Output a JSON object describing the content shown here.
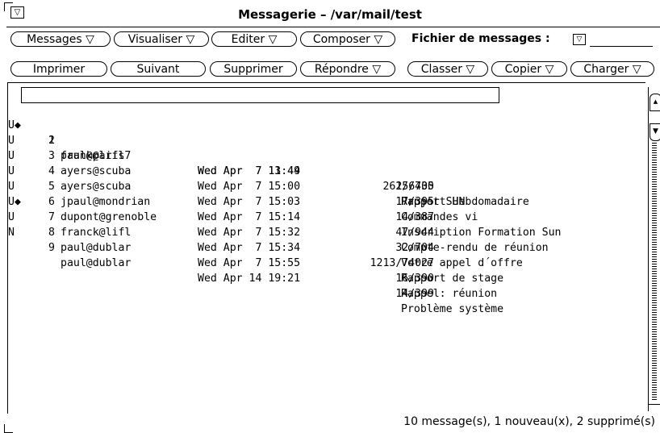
{
  "window": {
    "menu_glyph": "▽",
    "title": "Messagerie  – /var/mail/test"
  },
  "toolbar_row1": [
    {
      "label": "Messages ▽"
    },
    {
      "label": "Visualiser ▽"
    },
    {
      "label": "Editer   ▽"
    },
    {
      "label": "Composer ▽"
    }
  ],
  "mail_file": {
    "label": "Fichier de messages :",
    "dropdown_glyph": "▽",
    "value": ""
  },
  "toolbar_row2": [
    {
      "label": "Imprimer"
    },
    {
      "label": "Suivant"
    },
    {
      "label": "Supprimer"
    },
    {
      "label": "Répondre  ▽"
    },
    {
      "label": "Classer ▽"
    },
    {
      "label": "Copier ▽"
    },
    {
      "label": "Charger ▽"
    }
  ],
  "messages": [
    {
      "status": "",
      "num": "1",
      "from": "frank@lifl",
      "date": "Wed Apr  7 11:44",
      "size": "15/430",
      "subject": "Projet SUN",
      "selected": true
    },
    {
      "status": "U◆",
      "num": "2",
      "from": "paul@paris7",
      "date": "Wed Apr  7 13:49",
      "size": "262/6705",
      "subject": "Rapport Hebdomadaire"
    },
    {
      "status": "U",
      "num": "3",
      "from": "ayers@scuba",
      "date": "Wed Apr  7 15:00",
      "size": "17/395",
      "subject": "Commandes vi"
    },
    {
      "status": "U",
      "num": "4",
      "from": "ayers@scuba",
      "date": "Wed Apr  7 15:03",
      "size": "14/387",
      "subject": "Inscription Formation Sun"
    },
    {
      "status": "U",
      "num": "5",
      "from": "jpaul@mondrian",
      "date": "Wed Apr  7 15:14",
      "size": "47/944",
      "subject": "Compte-rendu de réunion"
    },
    {
      "status": "U",
      "num": "6",
      "from": "dupont@grenoble",
      "date": "Wed Apr  7 15:32",
      "size": "32/704",
      "subject": "Votre appel d´offre"
    },
    {
      "status": "U◆",
      "num": "7",
      "from": "franck@lifl",
      "date": "Wed Apr  7 15:34",
      "size": "1213/74027",
      "subject": "Rapport de stage"
    },
    {
      "status": "U",
      "num": "8",
      "from": "paul@dublar",
      "date": "Wed Apr  7 15:55",
      "size": "16/390",
      "subject": "Rappel: réunion"
    },
    {
      "status": "N",
      "num": "9",
      "from": "paul@dublar",
      "date": "Wed Apr 14 19:21",
      "size": "14/399",
      "subject": "Problème système"
    }
  ],
  "status_bar": "10 message(s), 1 nouveau(x), 2 supprimé(s)",
  "scrollbar": {
    "up_glyph": "▲",
    "down_glyph": "▼"
  }
}
